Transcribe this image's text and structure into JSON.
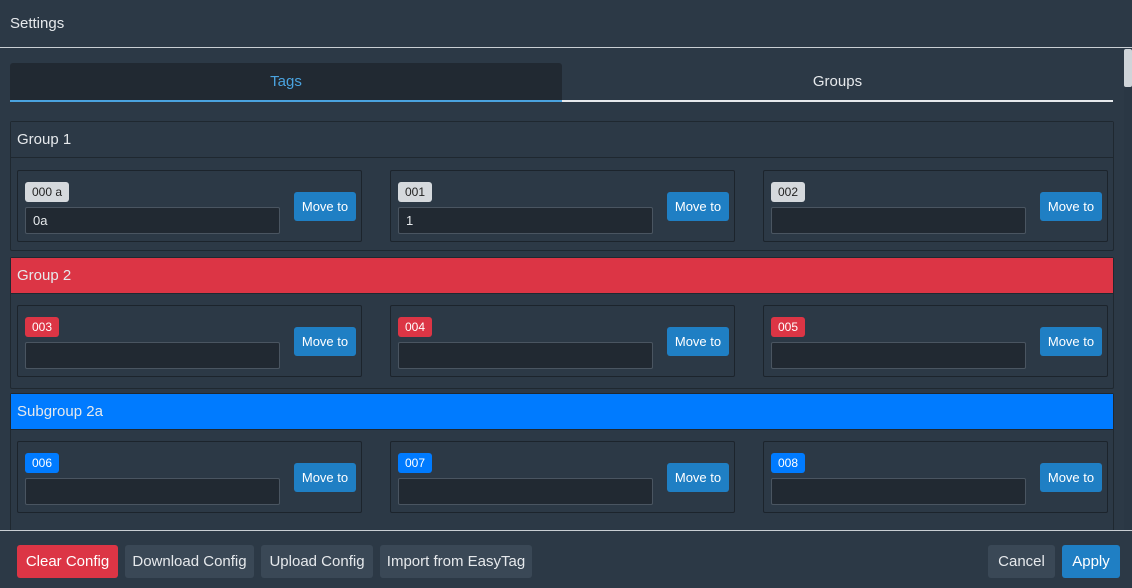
{
  "header": {
    "title": "Settings"
  },
  "tabs": [
    {
      "label": "Tags",
      "active": true
    },
    {
      "label": "Groups",
      "active": false
    }
  ],
  "move_label": "Move to",
  "groups": [
    {
      "name": "Group 1",
      "color": "default",
      "tags": [
        {
          "id": "000 a",
          "value": "0a"
        },
        {
          "id": "001",
          "value": "1"
        },
        {
          "id": "002",
          "value": ""
        }
      ]
    },
    {
      "name": "Group 2",
      "color": "#dc3545",
      "tags": [
        {
          "id": "003",
          "value": ""
        },
        {
          "id": "004",
          "value": ""
        },
        {
          "id": "005",
          "value": ""
        }
      ]
    },
    {
      "name": "Subgroup 2a",
      "color": "#007bff",
      "tags": [
        {
          "id": "006",
          "value": ""
        },
        {
          "id": "007",
          "value": ""
        },
        {
          "id": "008",
          "value": ""
        }
      ]
    }
  ],
  "footer": {
    "clear_label": "Clear Config",
    "download_label": "Download Config",
    "upload_label": "Upload Config",
    "import_label": "Import from EasyTag",
    "cancel_label": "Cancel",
    "apply_label": "Apply"
  },
  "colors": {
    "accent": "#4aa3df",
    "danger": "#dc3545",
    "primary": "#007bff",
    "button": "#1f7fc4"
  }
}
